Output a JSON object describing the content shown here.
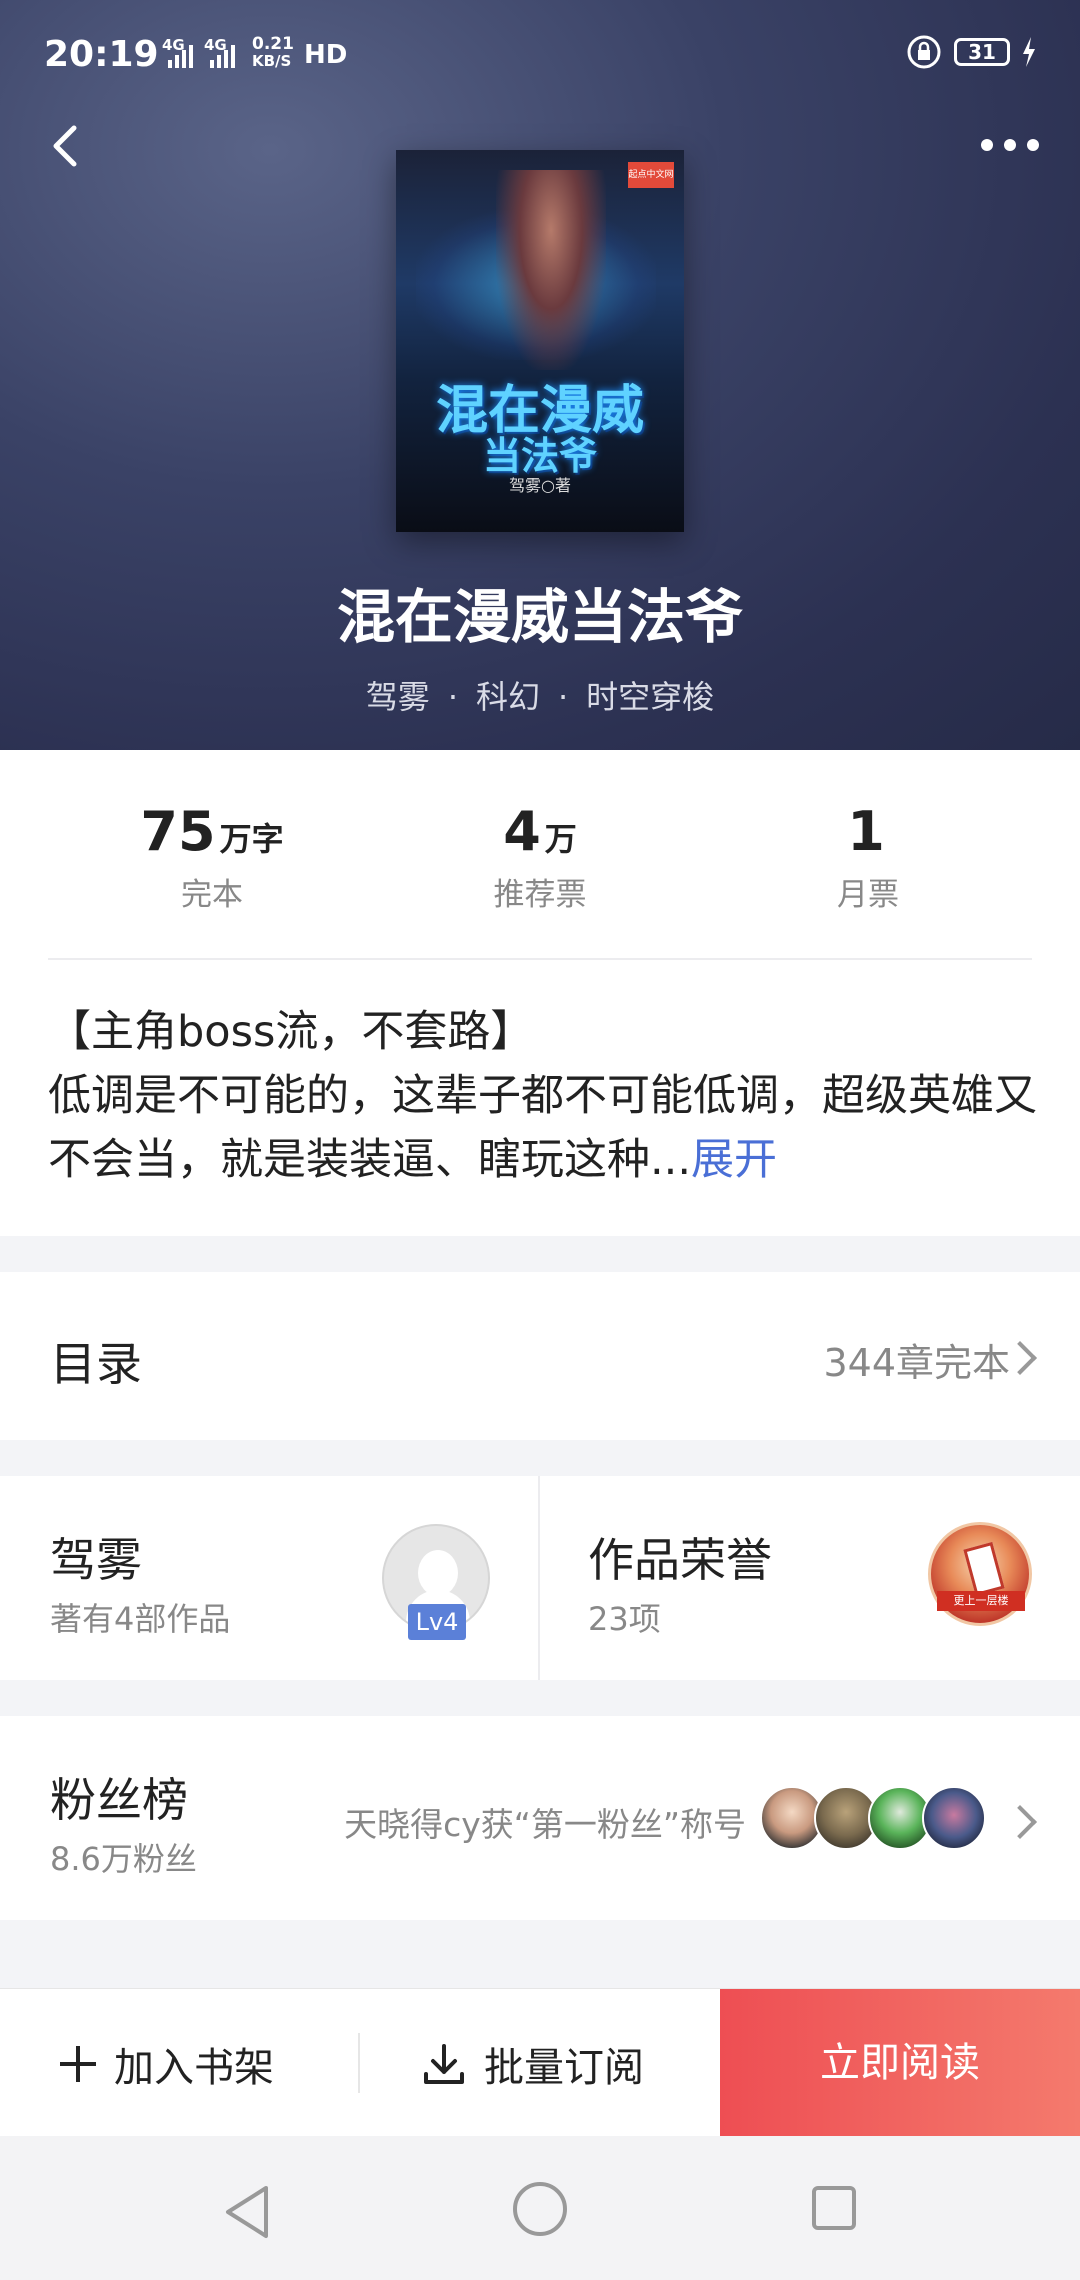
{
  "status_bar": {
    "time": "20:19",
    "network_1": "4G",
    "network_2": "4G",
    "speed": "0.21",
    "speed_unit": "KB/S",
    "hd": "HD",
    "battery": "31"
  },
  "header": {
    "cover_title_line1": "混在漫威",
    "cover_title_line2": "当法爷",
    "cover_author": "驾雾○著",
    "cover_publisher_badge": "起点中文网",
    "book_title": "混在漫威当法爷",
    "author": "驾雾",
    "category": "科幻",
    "subcategory": "时空穿梭"
  },
  "stats": [
    {
      "num": "75",
      "unit": "万字",
      "label": "完本"
    },
    {
      "num": "4",
      "unit": "万",
      "label": "推荐票"
    },
    {
      "num": "1",
      "unit": "",
      "label": "月票"
    }
  ],
  "intro": {
    "text": "【主角boss流，不套路】\n低调是不可能的，这辈子都不可能低调，超级英雄又不会当，就是装装逼、瞎玩这种...",
    "expand_label": "展开"
  },
  "toc": {
    "title": "目录",
    "status": "344章完本"
  },
  "author_card": {
    "name": "驾雾",
    "works": "著有4部作品",
    "level": "Lv4"
  },
  "honor_card": {
    "title": "作品荣誉",
    "count": "23项",
    "badge_text": "更上一层楼"
  },
  "fans": {
    "title": "粉丝榜",
    "count": "8.6万粉丝",
    "message": "天晓得cy获“第一粉丝”称号"
  },
  "bottom_bar": {
    "add_shelf": "加入书架",
    "batch_subscribe": "批量订阅",
    "read_now": "立即阅读"
  },
  "colors": {
    "accent_blue": "#4a6fd6",
    "read_button": "#ee4e53",
    "hero_bg": "#2c3152"
  }
}
